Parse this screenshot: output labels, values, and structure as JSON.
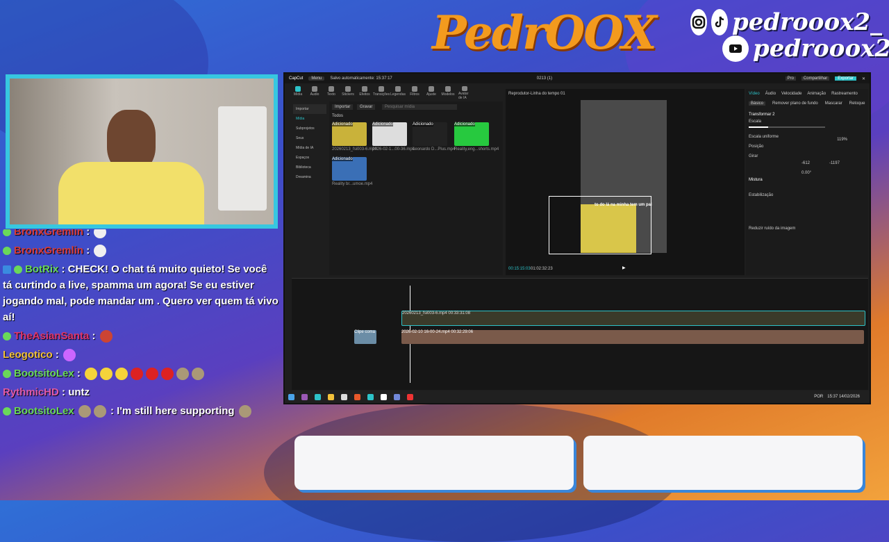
{
  "brand": {
    "logo": "PedrOOX",
    "handle_top": "pedrooox2_",
    "handle_bottom": "pedrooox2_"
  },
  "chat": {
    "messages": [
      {
        "user": "BronxGremlin",
        "color": "#d63b3b",
        "text": ":"
      },
      {
        "user": "BronxGremlin",
        "color": "#d63b3b",
        "text": ":"
      },
      {
        "user": "BotRix",
        "color": "#6ad85a",
        "text": ": CHECK! O chat tá muito quieto! Se você tá curtindo a live, spamma um  agora! Se eu estiver jogando mal, pode mandar um . Quero ver quem tá vivo aí!"
      },
      {
        "user": "TheAsianSanta",
        "color": "#e0356b",
        "text": ":"
      },
      {
        "user": "Leogotico",
        "color": "#f3c23a",
        "text": ":"
      },
      {
        "user": "BootsitoLex",
        "color": "#6ad85a",
        "text": ":"
      },
      {
        "user": "RythmicHD",
        "color": "#e05aa6",
        "text": ": untz"
      },
      {
        "user": "BootsitoLex",
        "color": "#6ad85a",
        "text": ": I'm still here supporting"
      }
    ]
  },
  "app": {
    "title": "CapCut",
    "menu": "Menu",
    "autosave": "Salvo automaticamente: 15:37:17",
    "project": "0213 (1)",
    "pro": "Pro",
    "share": "Compartilhar",
    "export": "Exportar",
    "tools": [
      "Mídia",
      "Áudio",
      "Texto",
      "Stickers",
      "Efeitos",
      "Transições",
      "Legendas",
      "Filtros",
      "Ajuste",
      "Modelos",
      "Avatar de IA"
    ],
    "leftnav": [
      "Importar",
      "Mídia",
      "Subprojetos",
      "Seus",
      "Mídia de IA",
      "Espaços",
      "Biblioteca",
      "Dreamina"
    ],
    "import_btn": "Importar",
    "record_btn": "Gravar",
    "search_placeholder": "Pesquisar mídia",
    "all": "Todos",
    "thumbs": [
      {
        "tag": "Adicionado",
        "dur": "00:33:",
        "name": "20260213_fsi003-6.mp4"
      },
      {
        "tag": "Adicionado",
        "dur": "02:25",
        "name": "2026-02-1...00-36.mp4"
      },
      {
        "tag": "Adicionado",
        "dur": "",
        "name": "Leonardo D...Plus.mp4"
      },
      {
        "tag": "Adicionado",
        "dur": "00:11",
        "name": "Reality,eng...shorts.mp4"
      },
      {
        "tag": "Adicionado",
        "dur": "",
        "name": "Reality br...umoe.mp4"
      }
    ],
    "player_title": "Reprodutor-Linha do tempo 01",
    "caption": "to  do lá na minha tem um pai",
    "time_current": "00:15:15:03",
    "time_total": "01:02:32:23",
    "panel_tabs": [
      "Vídeo",
      "Áudio",
      "Velocidade",
      "Animação",
      "Rastreamento"
    ],
    "panel_subtabs": [
      "Básico",
      "Remover plano de fundo",
      "Mascarar",
      "Retoque"
    ],
    "transform": "Transformar 2",
    "scale": "Escala",
    "scale_value": "119%",
    "uniform": "Escala uniforme",
    "position": "Posição",
    "pos_x": "-612",
    "pos_y": "-1197",
    "rotate": "Girar",
    "rotate_value": "0.00°",
    "blend": "Mistura",
    "stabilize": "Estabilização",
    "reduce_noise": "Reduzir ruído da imagem",
    "clip1": "20260213_fsi003-6.mp4  00:33:31:08",
    "clip2": "2026-02-10 16-00-24.mp4  00:32:29:06",
    "clip_side": "Clipe coma",
    "sys_time": "15:37",
    "sys_date": "14/02/2026",
    "sys_lang": "POR"
  }
}
